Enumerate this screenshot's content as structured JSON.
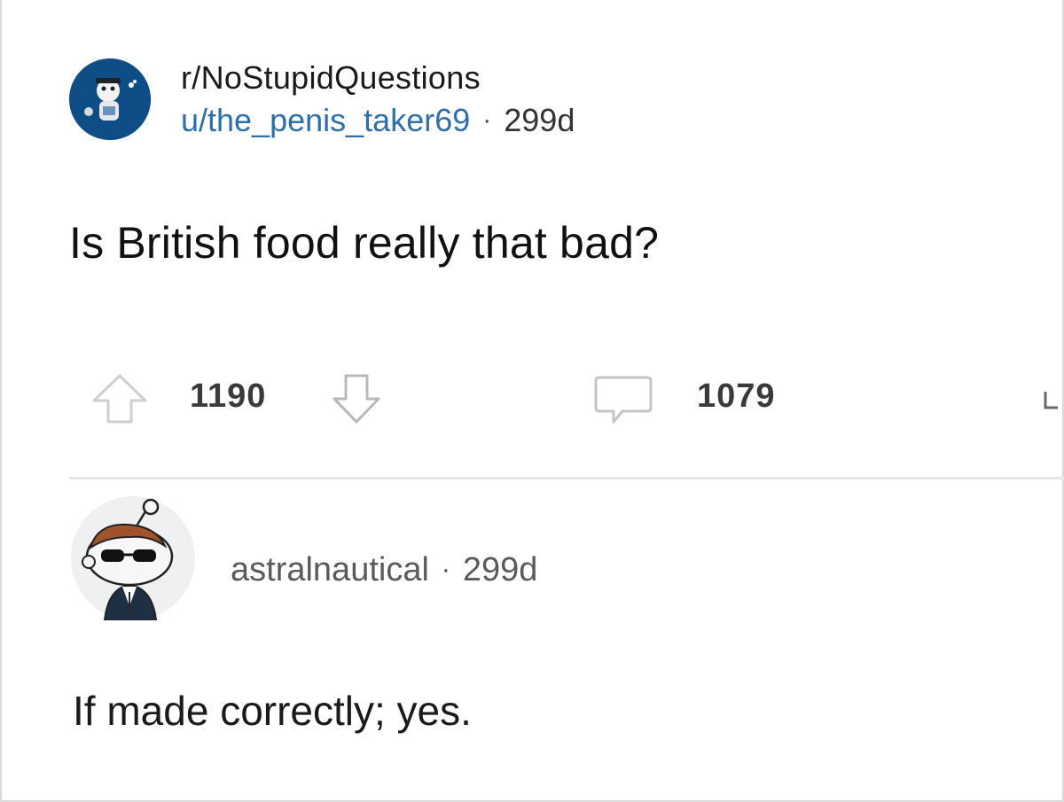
{
  "post": {
    "subreddit": "r/NoStupidQuestions",
    "author": "u/the_penis_taker69",
    "separator": "·",
    "age": "299d",
    "title": "Is British food really that bad?",
    "subreddit_icon": "subreddit-avatar-icon"
  },
  "actions": {
    "upvote_icon": "upvote-arrow-icon",
    "vote_count": "1190",
    "downvote_icon": "downvote-arrow-icon",
    "comment_icon": "comment-bubble-icon",
    "comment_count": "1079",
    "share_icon": "share-icon"
  },
  "comment": {
    "author": "astralnautical",
    "separator": "·",
    "age": "299d",
    "body": "If made correctly; yes.",
    "avatar_icon": "snoo-sunglasses-avatar-icon"
  },
  "colors": {
    "author_link": "#2e6fa7",
    "icon_gray": "#c8c8c8",
    "divider": "#e6e6e6"
  }
}
